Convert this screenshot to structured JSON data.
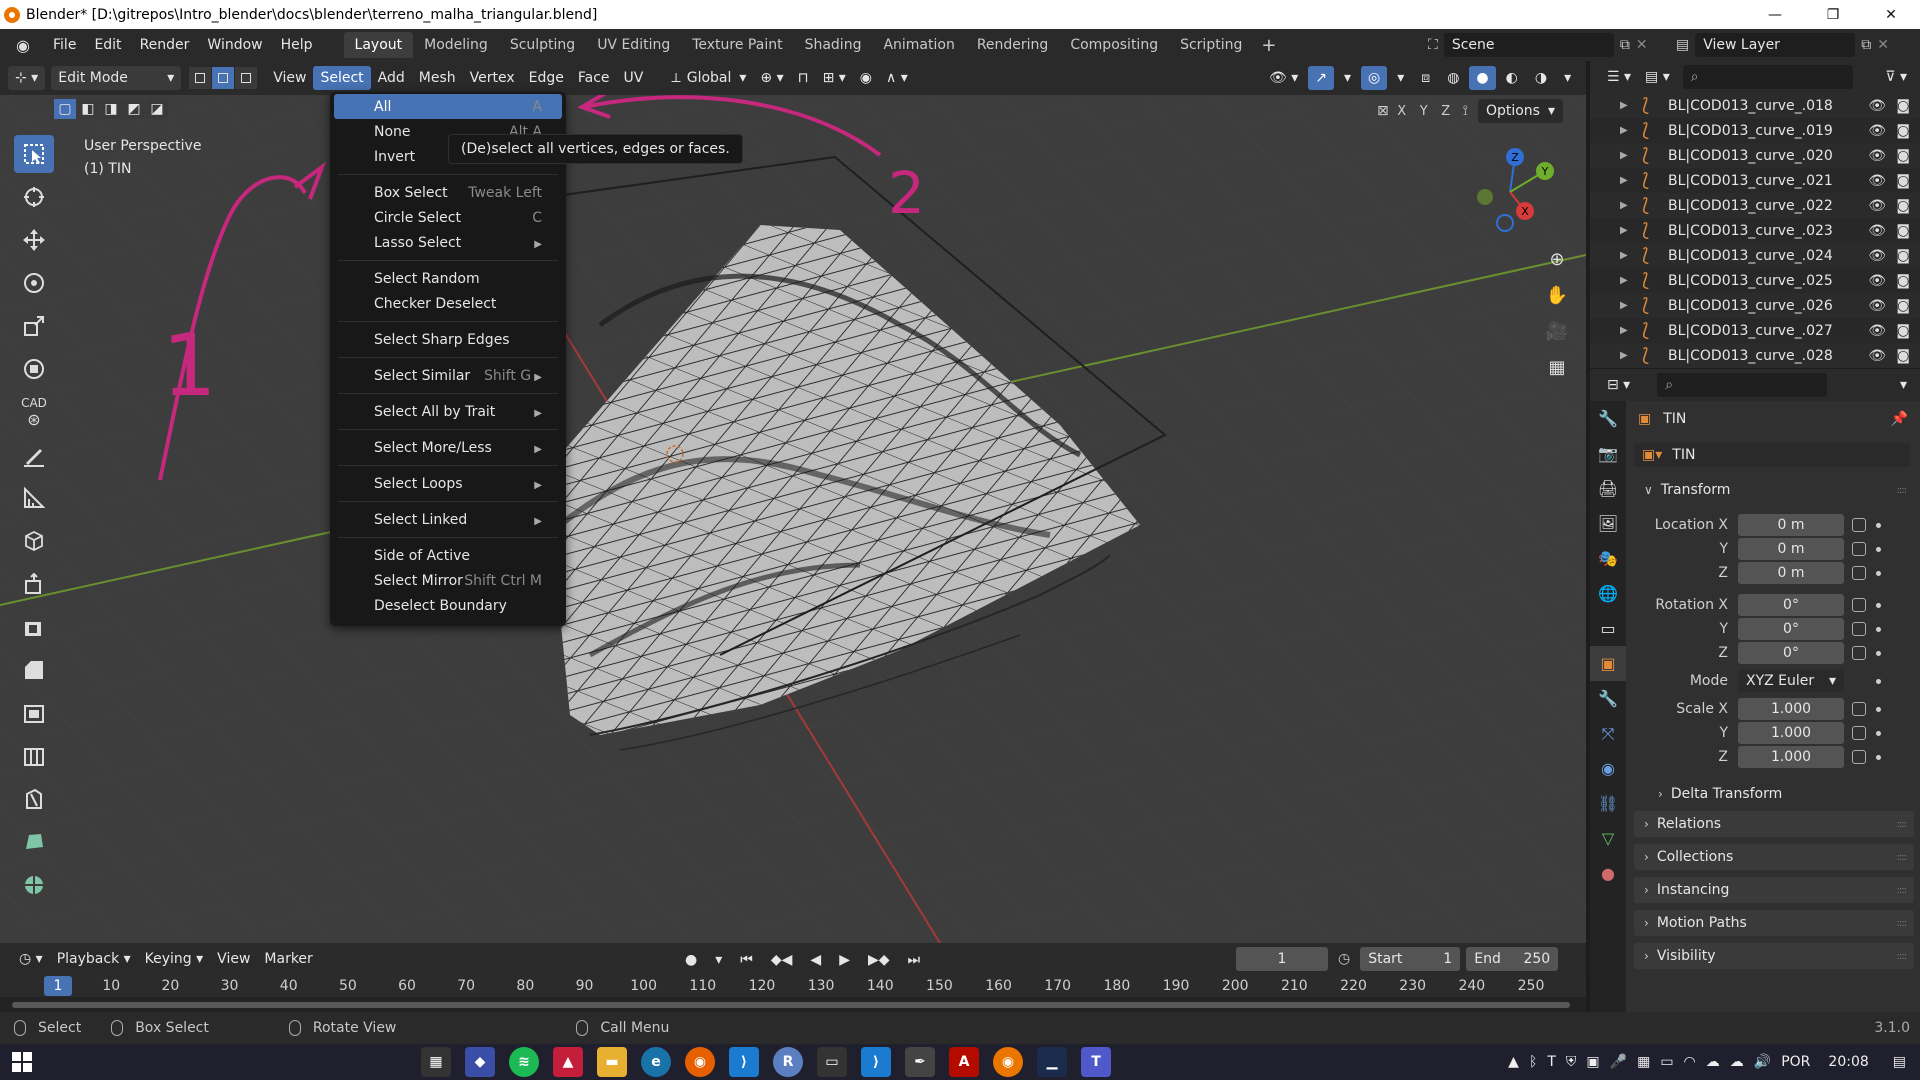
{
  "window": {
    "title": "Blender* [D:\\gitrepos\\Intro_blender\\docs\\blender\\terreno_malha_triangular.blend]",
    "controls": [
      "—",
      "❐",
      "✕"
    ]
  },
  "menubar": {
    "menus": [
      "File",
      "Edit",
      "Render",
      "Window",
      "Help"
    ],
    "workspaces": [
      "Layout",
      "Modeling",
      "Sculpting",
      "UV Editing",
      "Texture Paint",
      "Shading",
      "Animation",
      "Rendering",
      "Compositing",
      "Scripting"
    ],
    "active_workspace": "Layout",
    "add_workspace": "+",
    "scene_label": "Scene",
    "view_layer_label": "View Layer"
  },
  "viewport_header": {
    "mode": "Edit Mode",
    "menus": [
      "View",
      "Select",
      "Add",
      "Mesh",
      "Vertex",
      "Edge",
      "Face",
      "UV"
    ],
    "active_menu": "Select",
    "transform_orientation": "Global",
    "options_label": "Options",
    "axes": [
      "X",
      "Y",
      "Z"
    ]
  },
  "viewport": {
    "view_name": "User Perspective",
    "object_name": "(1) TIN",
    "gizmo_axes": [
      "Z",
      "Y",
      "X"
    ],
    "annotations": [
      "1",
      "2"
    ],
    "tool_cad_label": "CAD"
  },
  "select_menu": {
    "items": [
      {
        "label": "All",
        "shortcut": "A",
        "sub": false,
        "highlight": true
      },
      {
        "label": "None",
        "shortcut": "Alt A",
        "sub": false
      },
      {
        "label": "Invert",
        "shortcut": "",
        "sub": false
      },
      {
        "sep": true
      },
      {
        "label": "Box Select",
        "shortcut": "Tweak Left",
        "sub": false
      },
      {
        "label": "Circle Select",
        "shortcut": "C",
        "sub": false
      },
      {
        "label": "Lasso Select",
        "shortcut": "",
        "sub": true
      },
      {
        "sep": true
      },
      {
        "label": "Select Random",
        "shortcut": "",
        "sub": false
      },
      {
        "label": "Checker Deselect",
        "shortcut": "",
        "sub": false
      },
      {
        "sep": true
      },
      {
        "label": "Select Sharp Edges",
        "shortcut": "",
        "sub": false
      },
      {
        "sep": true
      },
      {
        "label": "Select Similar",
        "shortcut": "Shift G",
        "sub": true
      },
      {
        "sep": true
      },
      {
        "label": "Select All by Trait",
        "shortcut": "",
        "sub": true
      },
      {
        "sep": true
      },
      {
        "label": "Select More/Less",
        "shortcut": "",
        "sub": true
      },
      {
        "sep": true
      },
      {
        "label": "Select Loops",
        "shortcut": "",
        "sub": true
      },
      {
        "sep": true
      },
      {
        "label": "Select Linked",
        "shortcut": "",
        "sub": true
      },
      {
        "sep": true
      },
      {
        "label": "Side of Active",
        "shortcut": "",
        "sub": false
      },
      {
        "label": "Select Mirror",
        "shortcut": "Shift Ctrl M",
        "sub": false
      },
      {
        "label": "Deselect Boundary",
        "shortcut": "",
        "sub": false
      }
    ],
    "tooltip": "(De)select all vertices, edges or faces."
  },
  "timeline": {
    "menus": [
      "Playback",
      "Keying",
      "View",
      "Marker"
    ],
    "current_frame": "1",
    "start_label": "Start",
    "start": "1",
    "end_label": "End",
    "end": "250",
    "ruler": [
      "1",
      "10",
      "20",
      "30",
      "40",
      "50",
      "60",
      "70",
      "80",
      "90",
      "100",
      "110",
      "120",
      "130",
      "140",
      "150",
      "160",
      "170",
      "180",
      "190",
      "200",
      "210",
      "220",
      "230",
      "240",
      "250"
    ]
  },
  "statusbar": {
    "hints": [
      "Select",
      "Box Select",
      "Rotate View",
      "Call Menu"
    ],
    "version": "3.1.0"
  },
  "outliner": {
    "items": [
      "BL|COD013_curve_.018",
      "BL|COD013_curve_.019",
      "BL|COD013_curve_.020",
      "BL|COD013_curve_.021",
      "BL|COD013_curve_.022",
      "BL|COD013_curve_.023",
      "BL|COD013_curve_.024",
      "BL|COD013_curve_.025",
      "BL|COD013_curve_.026",
      "BL|COD013_curve_.027",
      "BL|COD013_curve_.028"
    ]
  },
  "properties": {
    "object_name": "TIN",
    "object_data_name": "TIN",
    "transform_title": "Transform",
    "location_label": "Location X",
    "location": [
      "0 m",
      "0 m",
      "0 m"
    ],
    "rotation_label": "Rotation X",
    "rotation": [
      "0°",
      "0°",
      "0°"
    ],
    "mode_label": "Mode",
    "mode": "XYZ Euler",
    "scale_label": "Scale X",
    "scale": [
      "1.000",
      "1.000",
      "1.000"
    ],
    "axis_y": "Y",
    "axis_z": "Z",
    "delta_transform": "Delta Transform",
    "collapsed_panels": [
      "Relations",
      "Collections",
      "Instancing",
      "Motion Paths",
      "Visibility"
    ]
  },
  "taskbar": {
    "tray": {
      "lang": "POR",
      "time": "20:08"
    }
  }
}
